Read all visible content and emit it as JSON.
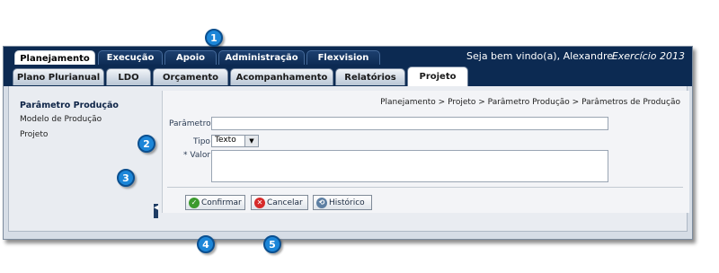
{
  "top_tabs": [
    "Planejamento",
    "Execução",
    "Apoio",
    "Administração",
    "Flexvision"
  ],
  "welcome": "Seja bem vindo(a), Alexandre",
  "exercise": "Exercício 2013",
  "sub_tabs": [
    "Plano Plurianual",
    "LDO",
    "Orçamento",
    "Acompanhamento",
    "Relatórios",
    "Projeto"
  ],
  "sidebar": {
    "title": "Parâmetro Produção",
    "items": [
      "Modelo de Produção",
      "Projeto"
    ]
  },
  "breadcrumb": "Planejamento > Projeto > Parâmetro Produção > Parâmetros de Produção",
  "form": {
    "parametro_label": "Parâmetro",
    "parametro_value": "",
    "tipo_label": "Tipo",
    "tipo_value": "Texto",
    "valor_label": "* Valor",
    "valor_value": ""
  },
  "buttons": {
    "confirmar": "Confirmar",
    "cancelar": "Cancelar",
    "historico": "Histórico"
  },
  "callouts": [
    "1",
    "2",
    "3",
    "4",
    "5"
  ],
  "colors": {
    "nav_bg": "#0c2a52",
    "callout": "#1c86d8",
    "confirm": "#3c9a2e",
    "cancel": "#d62a2a"
  }
}
